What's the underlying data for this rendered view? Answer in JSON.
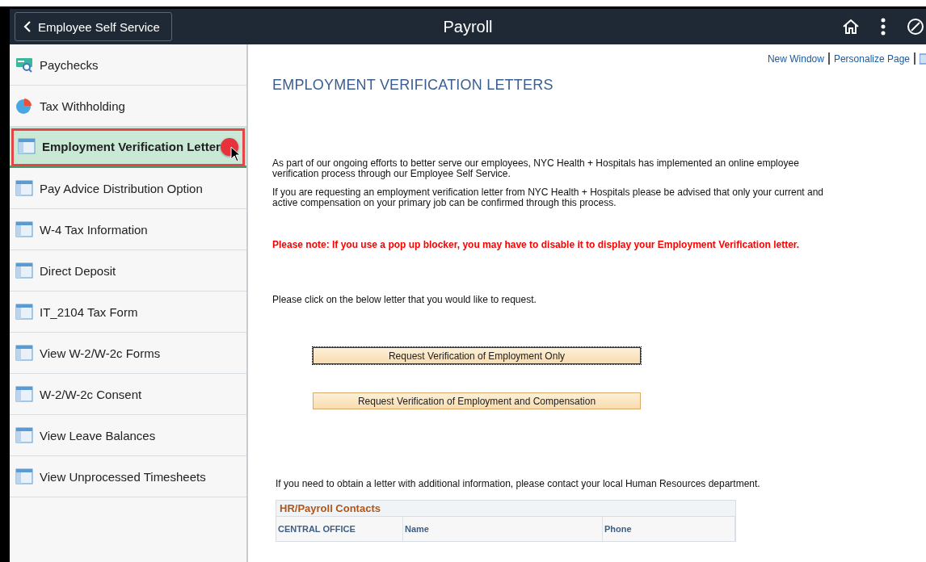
{
  "header": {
    "back_button": "Employee Self Service",
    "title": "Payroll"
  },
  "sidebar": {
    "items": [
      {
        "label": "Paychecks",
        "kind": "check",
        "selected": false
      },
      {
        "label": "Tax Withholding",
        "kind": "pie",
        "selected": false
      },
      {
        "label": "Employment Verification Letter",
        "kind": "page",
        "selected": true
      },
      {
        "label": "Pay Advice Distribution Option",
        "kind": "page",
        "selected": false
      },
      {
        "label": "W-4 Tax Information",
        "kind": "page",
        "selected": false
      },
      {
        "label": "Direct Deposit",
        "kind": "page",
        "selected": false
      },
      {
        "label": "IT_2104 Tax Form",
        "kind": "page",
        "selected": false
      },
      {
        "label": "View W-2/W-2c Forms",
        "kind": "page",
        "selected": false
      },
      {
        "label": "W-2/W-2c Consent",
        "kind": "page",
        "selected": false
      },
      {
        "label": "View Leave Balances",
        "kind": "page",
        "selected": false
      },
      {
        "label": "View Unprocessed Timesheets",
        "kind": "page",
        "selected": false
      }
    ]
  },
  "page_links": [
    "New Window",
    "Personalize Page"
  ],
  "page_title": "EMPLOYMENT VERIFICATION LETTERS",
  "intro": [
    "As part of our ongoing efforts to better serve our employees, NYC Health + Hospitals has implemented an online employee verification process through our Employee Self Service.",
    "If you are requesting an employment verification letter from NYC Health + Hospitals please be advised that only your current and active compensation on your primary job can be confirmed through this process."
  ],
  "warning": "Please note: If you use a pop up blocker, you may have to disable it to display your Employment Verification letter.",
  "instruction": "Please click on the below letter that you would like to request.",
  "buttons": [
    {
      "label": "Request Verification of Employment Only",
      "focused": true
    },
    {
      "label": "Request Verification of Employment and Compensation",
      "focused": false
    }
  ],
  "contact_note": "If you need to obtain a letter with additional information, please contact your local Human Resources department.",
  "contacts": {
    "title": "HR/Payroll Contacts",
    "columns": [
      "CENTRAL OFFICE",
      "Name",
      "Phone"
    ]
  }
}
